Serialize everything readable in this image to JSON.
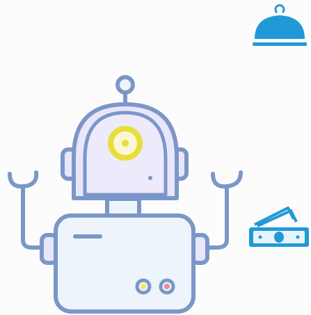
{
  "icons": {
    "robot": "robot-illustration",
    "service_bell": "cloche-icon",
    "money": "cash-banknotes-icon"
  },
  "colors": {
    "background": "#fcfcfd",
    "robot_outline": "#7b97c8",
    "robot_head_fill": "#e9e6fb",
    "robot_body_fill": "#eef4fc",
    "robot_face_fill": "#edeafb",
    "eye_ring": "#e8de3a",
    "eye_inner": "#fbf6d6",
    "button_yellow": "#f3e56d",
    "button_pink": "#ee8792",
    "accent_blue": "#209ad6"
  }
}
